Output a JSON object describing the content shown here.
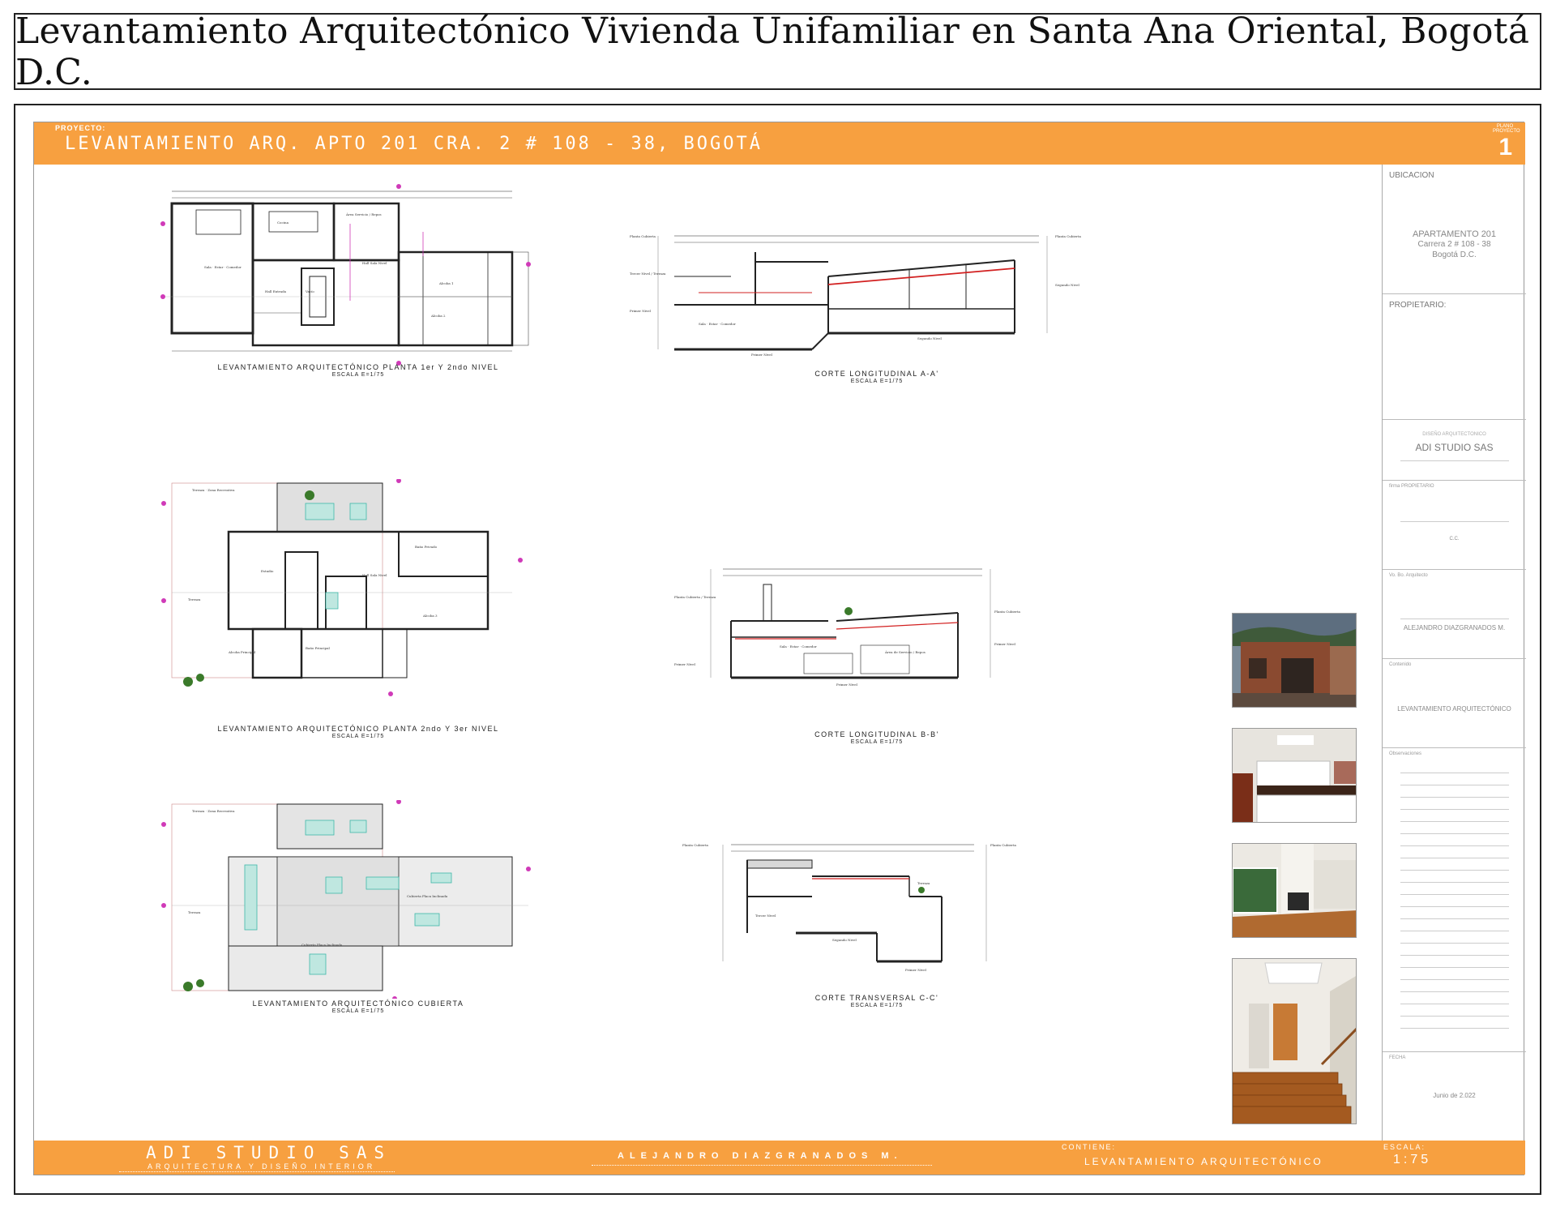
{
  "header": {
    "title": "Levantamiento Arquitectónico Vivienda Unifamiliar en Santa Ana Oriental, Bogotá D.C."
  },
  "top_bar": {
    "project_label": "PROYECTO:",
    "project_title": "LEVANTAMIENTO ARQ. APTO 201 CRA. 2 # 108 - 38, BOGOTÁ",
    "plano_label": "PLANO PROYECTO",
    "plano_number": "1"
  },
  "panel": {
    "ubicacion_label": "UBICACION",
    "address_line1": "APARTAMENTO 201",
    "address_line2": "Carrera 2 # 108 - 38",
    "address_line3": "Bogotá D.C.",
    "propietario_label": "PROPIETARIO:",
    "diseno_label": "DISEÑO ARQUITECTONICO",
    "studio_name": "ADI STUDIO SAS",
    "firma_label": "firma PROPIETARIO",
    "cc_label": "C.C.",
    "arquitecto_label": "Vo. Bo. Arquitecto",
    "arquitecto_name": "ALEJANDRO DIAZGRANADOS M.",
    "contenido_label": "Contenido",
    "contenido_value": "LEVANTAMIENTO ARQUITECTÓNICO",
    "observaciones_label": "Observaciones",
    "fecha_label": "FECHA",
    "fecha_value": "Junio de 2.022"
  },
  "drawings": {
    "plan1_caption": "LEVANTAMIENTO ARQUITECTÓNICO PLANTA 1er Y 2ndo NIVEL",
    "plan2_caption": "LEVANTAMIENTO ARQUITECTÓNICO PLANTA 2ndo Y 3er NIVEL",
    "plan3_caption": "LEVANTAMIENTO ARQUITECTÓNICO CUBIERTA",
    "section_a_caption": "CORTE LONGITUDINAL A-A'",
    "section_b_caption": "CORTE LONGITUDINAL B-B'",
    "section_c_caption": "CORTE TRANSVERSAL C-C'",
    "scale_note": "ESCALA E=1/75"
  },
  "bottom_bar": {
    "studio": "ADI STUDIO SAS",
    "studio_sub": "ARQUITECTURA Y DISEÑO INTERIOR",
    "architect": "ALEJANDRO DIAZGRANADOS M.",
    "contiene_label": "CONTIENE:",
    "contiene_value": "LEVANTAMIENTO ARQUITECTÓNICO",
    "escala_label": "ESCALA:",
    "escala_value": "1:75"
  },
  "colors": {
    "accent": "#f7a040",
    "section_marker": "#d03ab8",
    "red_line": "#d22020",
    "teal_hatch": "#3fb7a8"
  }
}
